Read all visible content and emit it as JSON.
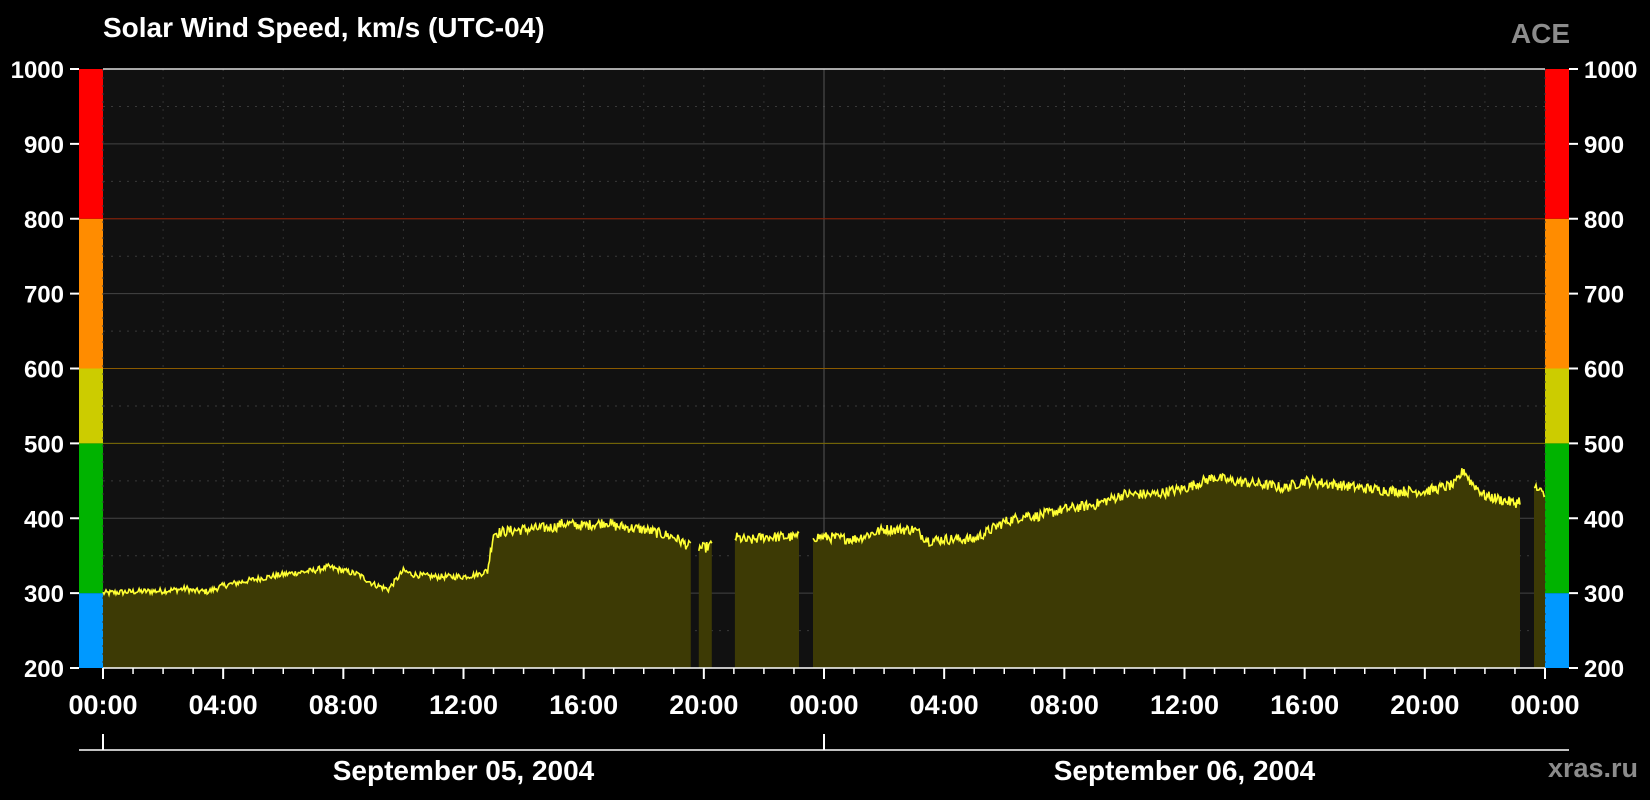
{
  "header": {
    "title": "Solar Wind Speed, km/s (UTC-04)",
    "source": "ACE"
  },
  "footer": {
    "site": "xras.ru"
  },
  "colors": {
    "background": "#000000",
    "plot_bg": "#111111",
    "line": "#ffff33",
    "fill": "#3d3a05",
    "grid": "#444444",
    "bands": [
      "#0099ff",
      "#00b300",
      "#cccc00",
      "#ff8c00",
      "#ff0000"
    ]
  },
  "chart_data": {
    "type": "area",
    "title": "Solar Wind Speed, km/s (UTC-04)",
    "ylim": [
      200,
      1000
    ],
    "yticks": [
      200,
      300,
      400,
      500,
      600,
      700,
      800,
      900,
      1000
    ],
    "ytick_labels": [
      "200",
      "300",
      "400",
      "500",
      "600",
      "700",
      "800",
      "900",
      "1000"
    ],
    "xlim_hours": [
      0,
      48
    ],
    "xtick_labels": [
      "00:00",
      "04:00",
      "08:00",
      "12:00",
      "16:00",
      "20:00",
      "00:00",
      "04:00",
      "08:00",
      "12:00",
      "16:00",
      "20:00",
      "00:00"
    ],
    "date_labels": [
      "September 05, 2004",
      "September 06, 2004"
    ],
    "threshold_lines": [
      500,
      600,
      800
    ],
    "bands": [
      {
        "from": 200,
        "to": 300,
        "color": "#0099ff"
      },
      {
        "from": 300,
        "to": 500,
        "color": "#00b300"
      },
      {
        "from": 500,
        "to": 600,
        "color": "#cccc00"
      },
      {
        "from": 600,
        "to": 800,
        "color": "#ff8c00"
      },
      {
        "from": 800,
        "to": 1000,
        "color": "#ff0000"
      }
    ],
    "grid": true,
    "series": [
      {
        "x_hours": [
          0,
          1,
          2,
          2.8,
          3,
          3.5,
          4,
          5,
          6,
          7,
          7.5,
          8,
          8.5,
          9,
          9.5,
          10,
          10.3,
          11,
          12,
          12.5,
          12.8,
          13,
          13.5,
          14,
          15,
          15.3,
          16,
          16.8,
          17,
          18,
          19,
          19.5,
          20,
          20.3,
          21,
          21.5,
          22,
          23,
          24,
          25,
          26,
          27,
          27.5,
          28,
          29,
          30,
          30.8,
          31,
          32,
          33,
          34,
          35,
          36,
          37,
          37.5,
          38,
          39,
          39.3,
          40,
          41,
          42,
          43,
          44,
          45,
          45.3,
          45.5,
          46,
          47,
          47.7,
          48
        ],
        "y": [
          300,
          302,
          303,
          306,
          303,
          302,
          310,
          318,
          325,
          330,
          335,
          330,
          325,
          312,
          305,
          330,
          325,
          322,
          322,
          325,
          330,
          380,
          383,
          385,
          388,
          393,
          390,
          395,
          390,
          385,
          375,
          363,
          360,
          365,
          375,
          370,
          375,
          375,
          375,
          372,
          385,
          385,
          370,
          372,
          372,
          395,
          405,
          402,
          412,
          418,
          432,
          432,
          440,
          455,
          450,
          448,
          443,
          440,
          450,
          445,
          440,
          436,
          436,
          445,
          465,
          450,
          430,
          420,
          440,
          430
        ],
        "gaps_hours": [
          [
            19.6,
            19.8
          ],
          [
            20.3,
            21.0
          ],
          [
            23.2,
            23.6
          ],
          [
            47.2,
            47.6
          ]
        ]
      }
    ]
  }
}
